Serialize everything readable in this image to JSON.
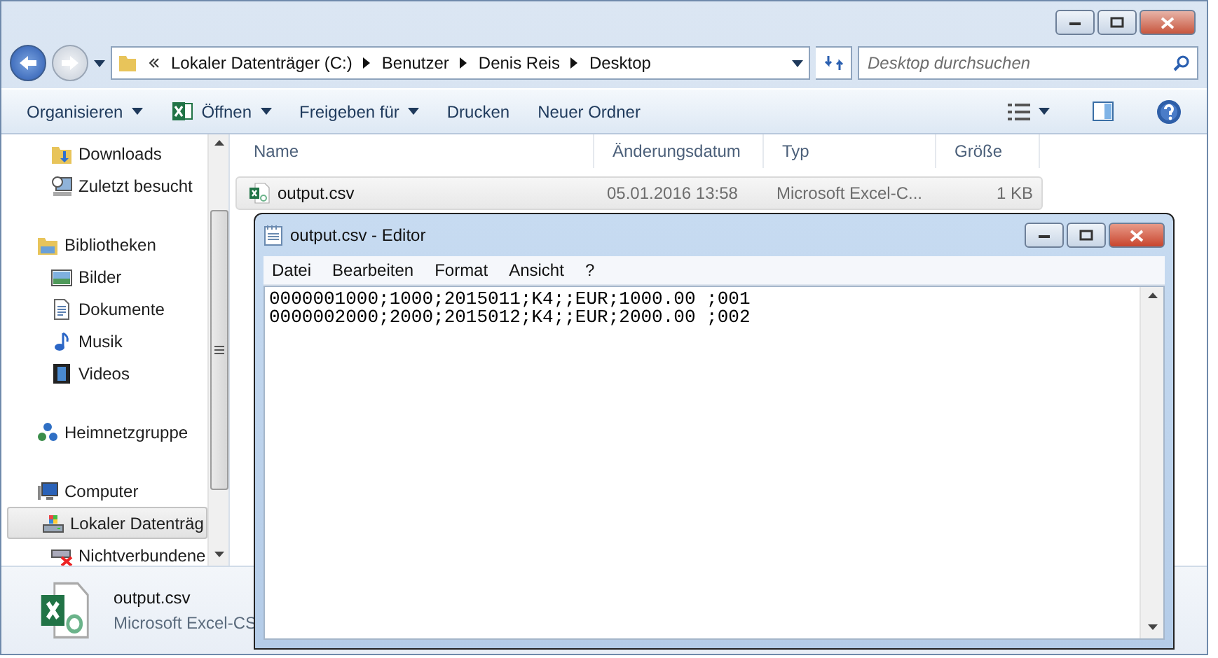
{
  "explorer": {
    "address": {
      "crumbs": [
        "Lokaler Datenträger (C:)",
        "Benutzer",
        "Denis Reis",
        "Desktop"
      ]
    },
    "search": {
      "placeholder": "Desktop durchsuchen"
    },
    "toolbar": [
      {
        "label": "Organisieren",
        "dropdown": true,
        "kind": "plain"
      },
      {
        "label": "Öffnen",
        "dropdown": true,
        "kind": "excel"
      },
      {
        "label": "Freigeben für",
        "dropdown": true,
        "kind": "plain"
      },
      {
        "label": "Drucken",
        "dropdown": false,
        "kind": "plain"
      },
      {
        "label": "Neuer Ordner",
        "dropdown": false,
        "kind": "plain"
      }
    ],
    "sidebar": {
      "groups": [
        {
          "children": [
            {
              "label": "Downloads",
              "kind": "downloads",
              "selected": false
            },
            {
              "label": "Zuletzt besucht",
              "kind": "recent",
              "selected": false
            }
          ]
        },
        {
          "label": "Bibliotheken",
          "kind": "library",
          "children": [
            {
              "label": "Bilder",
              "kind": "pictures",
              "selected": false
            },
            {
              "label": "Dokumente",
              "kind": "documents",
              "selected": false
            },
            {
              "label": "Musik",
              "kind": "music",
              "selected": false
            },
            {
              "label": "Videos",
              "kind": "videos",
              "selected": false
            }
          ]
        },
        {
          "label": "Heimnetzgruppe",
          "kind": "network"
        },
        {
          "label": "Computer",
          "kind": "computer",
          "children": [
            {
              "label": "Lokaler Datenträg",
              "kind": "drive",
              "selected": true
            },
            {
              "label": "Nichtverbundene",
              "kind": "netdrive",
              "selected": false
            }
          ]
        }
      ]
    },
    "table": {
      "columns": [
        "Name",
        "Änderungsdatum",
        "Typ",
        "Größe"
      ],
      "rows": [
        {
          "name": "output.csv",
          "date": "05.01.2016 13:58",
          "type": "Microsoft Excel-C...",
          "size": "1 KB",
          "selected": true
        }
      ]
    },
    "details": {
      "name": "output.csv",
      "type": "Microsoft Excel-CS"
    }
  },
  "editor": {
    "title": "output.csv - Editor",
    "menu": [
      "Datei",
      "Bearbeiten",
      "Format",
      "Ansicht",
      "?"
    ],
    "lines": [
      "0000001000;1000;2015011;K4;;EUR;1000.00 ;001",
      "0000002000;2000;2015012;K4;;EUR;2000.00 ;002"
    ]
  }
}
